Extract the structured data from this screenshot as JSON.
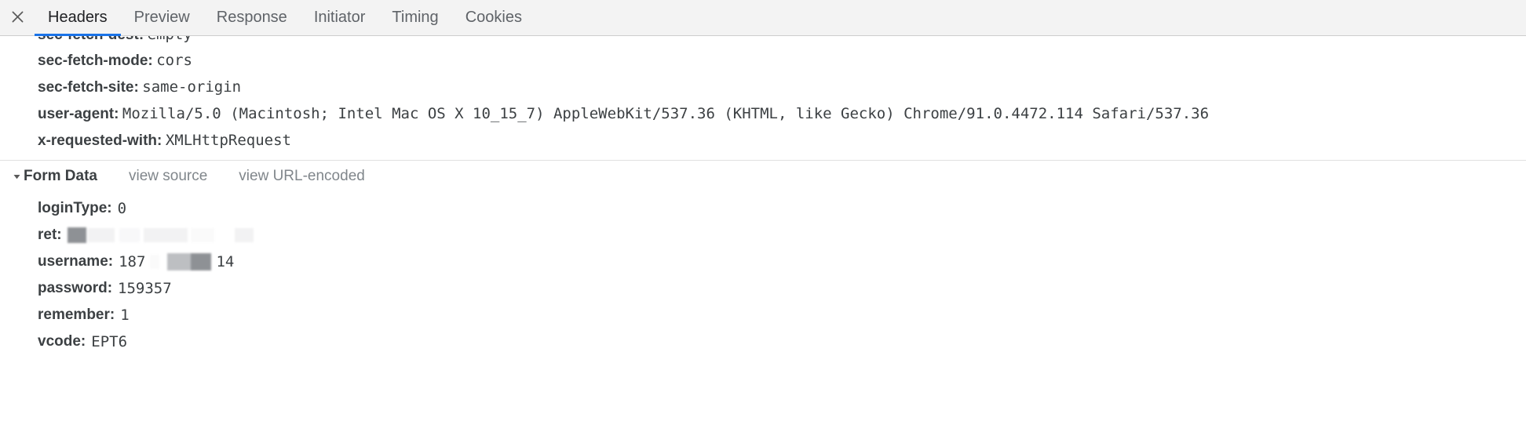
{
  "panel": {
    "close_icon": "close-icon",
    "tabs": [
      {
        "label": "Headers",
        "active": true
      },
      {
        "label": "Preview",
        "active": false
      },
      {
        "label": "Response",
        "active": false
      },
      {
        "label": "Initiator",
        "active": false
      },
      {
        "label": "Timing",
        "active": false
      },
      {
        "label": "Cookies",
        "active": false
      }
    ],
    "active_tab": "Headers",
    "accent_color": "#1a73e8",
    "tabbar_bg": "#f3f3f3",
    "text_color": "#3c4043",
    "muted_text_color": "#80868b"
  },
  "clipped_row": {
    "name": "sec-fetch-dest:",
    "value": "empty"
  },
  "request_headers": [
    {
      "name": "sec-fetch-mode:",
      "value": "cors"
    },
    {
      "name": "sec-fetch-site:",
      "value": "same-origin"
    },
    {
      "name": "user-agent:",
      "value": "Mozilla/5.0 (Macintosh; Intel Mac OS X 10_15_7) AppleWebKit/537.36 (KHTML, like Gecko) Chrome/91.0.4472.114 Safari/537.36"
    },
    {
      "name": "x-requested-with:",
      "value": "XMLHttpRequest"
    }
  ],
  "form_data_section": {
    "disclosure_icon": "triangle-down-icon",
    "title": "Form Data",
    "view_source_label": "view source",
    "view_url_encoded_label": "view URL-encoded",
    "expanded": true
  },
  "form_data": [
    {
      "key": "loginType:",
      "value": "0",
      "redacted": false
    },
    {
      "key": "ret:",
      "value": "",
      "redacted": true
    },
    {
      "key": "username:",
      "value_prefix": "187",
      "value_suffix": "14",
      "redacted": true
    },
    {
      "key": "password:",
      "value": "159357",
      "redacted": false
    },
    {
      "key": "remember:",
      "value": "1",
      "redacted": false
    },
    {
      "key": "vcode:",
      "value": "EPT6",
      "redacted": false
    }
  ]
}
